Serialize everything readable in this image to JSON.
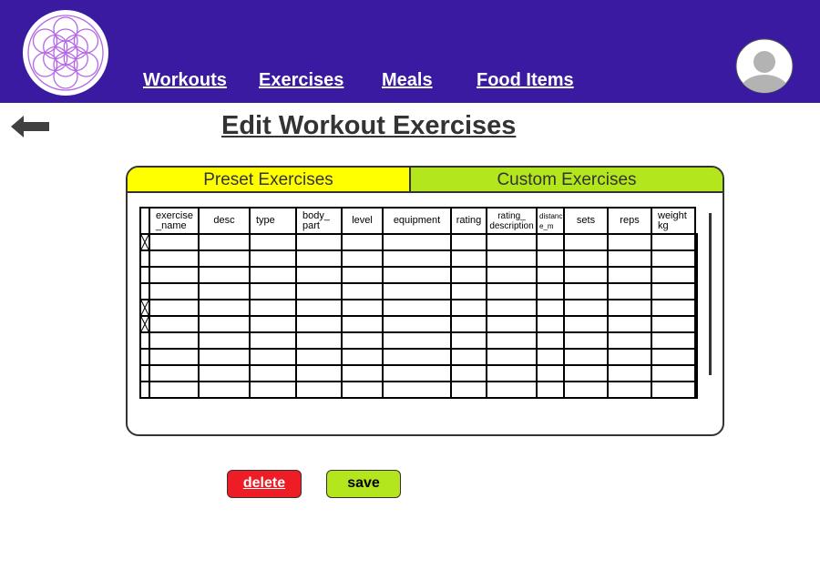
{
  "colors": {
    "header_bg": "#3a1aa0",
    "preset_tab": "#ffff00",
    "custom_tab": "#b3e61c",
    "delete_bg": "#ee1c24",
    "save_bg": "#b3e61c",
    "logo": "#b566e8"
  },
  "icons": {
    "logo": "flower-of-life-logo",
    "avatar": "user-avatar-icon",
    "back": "back-arrow-icon"
  },
  "nav": {
    "workouts": "Workouts",
    "exercises": "Exercises",
    "meals": "Meals",
    "food_items": "Food Items"
  },
  "page": {
    "title": "Edit Workout Exercises"
  },
  "tabs": {
    "preset": "Preset Exercises",
    "custom": "Custom Exercises"
  },
  "table": {
    "headers": {
      "exercise_name_1": "exercise",
      "exercise_name_2": "_name",
      "desc": "desc",
      "type": "type",
      "body_part_1": "body_",
      "body_part_2": "part",
      "level": "level",
      "equipment": "equipment",
      "rating": "rating",
      "rating_description_1": "rating_",
      "rating_description_2": "description",
      "distance_m_1": "distanc",
      "distance_m_2": "e_m",
      "sets": "sets",
      "reps": "reps",
      "weight_kg_1": "weight",
      "weight_kg_2": "kg"
    },
    "row_count": 10,
    "checked_rows": [
      0,
      4,
      5
    ]
  },
  "buttons": {
    "delete": "delete",
    "save": "save"
  }
}
